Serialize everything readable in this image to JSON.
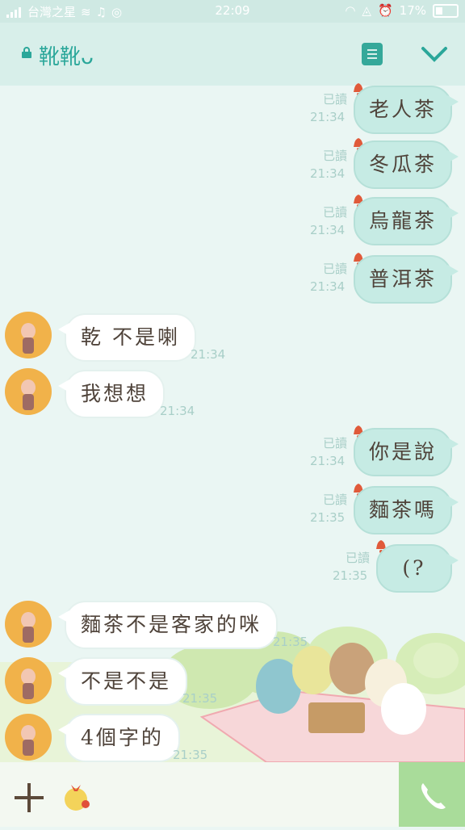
{
  "status_bar": {
    "carrier": "台灣之星",
    "time": "22:09",
    "battery": "17%"
  },
  "header": {
    "chat_title": "靴靴ᴗ"
  },
  "messages": [
    {
      "dir": "out",
      "text": "老人茶",
      "read": "已讀",
      "time": "21:34"
    },
    {
      "dir": "out",
      "text": "冬瓜茶",
      "read": "已讀",
      "time": "21:34"
    },
    {
      "dir": "out",
      "text": "烏龍茶",
      "read": "已讀",
      "time": "21:34"
    },
    {
      "dir": "out",
      "text": "普洱茶",
      "read": "已讀",
      "time": "21:34"
    },
    {
      "dir": "in",
      "text": "乾 不是喇",
      "time": "21:34"
    },
    {
      "dir": "in",
      "text": "我想想",
      "time": "21:34"
    },
    {
      "dir": "out",
      "text": "你是說",
      "read": "已讀",
      "time": "21:34"
    },
    {
      "dir": "out",
      "text": "麵茶嗎",
      "read": "已讀",
      "time": "21:35"
    },
    {
      "dir": "out",
      "text": "(?",
      "read": "已讀",
      "time": "21:35"
    },
    {
      "dir": "in",
      "text": "麵茶不是客家的咪",
      "time": "21:35"
    },
    {
      "dir": "in",
      "text": "不是不是",
      "time": "21:35"
    },
    {
      "dir": "in",
      "text": "4個字的",
      "time": "21:35"
    }
  ],
  "colors": {
    "accent": "#2ba79a",
    "bubble_out": "#c6ebe4",
    "bubble_in": "#ffffff",
    "call_button": "#a9dc9a"
  },
  "icons": [
    "lock-icon",
    "note-icon",
    "chevron-down-icon",
    "plus-icon",
    "sticker-icon",
    "phone-icon",
    "bell-icon"
  ]
}
